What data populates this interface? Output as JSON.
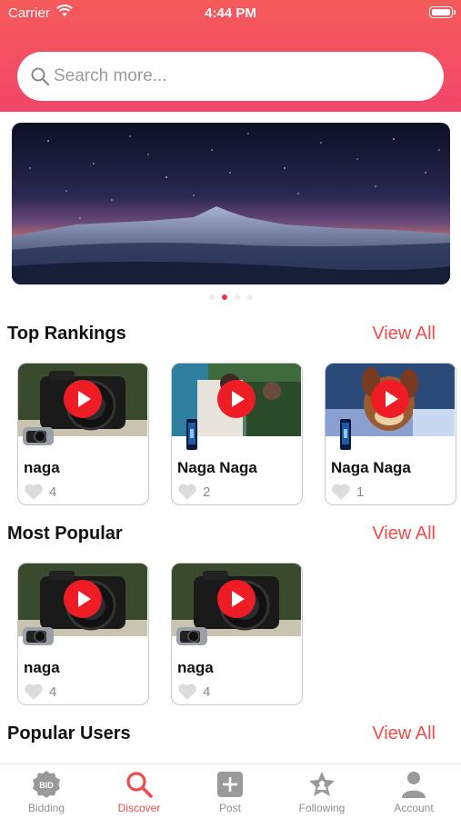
{
  "status_bar": {
    "carrier": "Carrier",
    "time": "4:44 PM"
  },
  "search": {
    "placeholder": "Search more..."
  },
  "banner": {
    "pages": 4,
    "active_page": 2
  },
  "top_rankings": {
    "title": "Top Rankings",
    "view_all": "View All",
    "items": [
      {
        "title": "naga",
        "likes": "4",
        "thumb": "camera",
        "badge": "camera"
      },
      {
        "title": "Naga Naga",
        "likes": "2",
        "thumb": "movie-scene",
        "badge": "phone"
      },
      {
        "title": "Naga Naga",
        "likes": "1",
        "thumb": "cartoon",
        "badge": "phone"
      }
    ]
  },
  "most_popular": {
    "title": "Most Popular",
    "view_all": "View All",
    "items": [
      {
        "title": "naga",
        "likes": "4",
        "thumb": "camera",
        "badge": "camera"
      },
      {
        "title": "naga",
        "likes": "4",
        "thumb": "camera",
        "badge": "camera"
      }
    ]
  },
  "popular_users": {
    "title": "Popular Users",
    "view_all": "View All"
  },
  "tabbar": {
    "active": "Discover",
    "tabs": [
      {
        "label": "Bidding",
        "icon": "bid-icon"
      },
      {
        "label": "Discover",
        "icon": "search-icon"
      },
      {
        "label": "Post",
        "icon": "plus-box-icon"
      },
      {
        "label": "Following",
        "icon": "following-star-icon"
      },
      {
        "label": "Account",
        "icon": "person-icon"
      }
    ]
  },
  "colors": {
    "accent": "#f04a4a",
    "header_top": "#f45a5a",
    "header_bottom": "#f2466a",
    "play": "#ee1d25"
  }
}
